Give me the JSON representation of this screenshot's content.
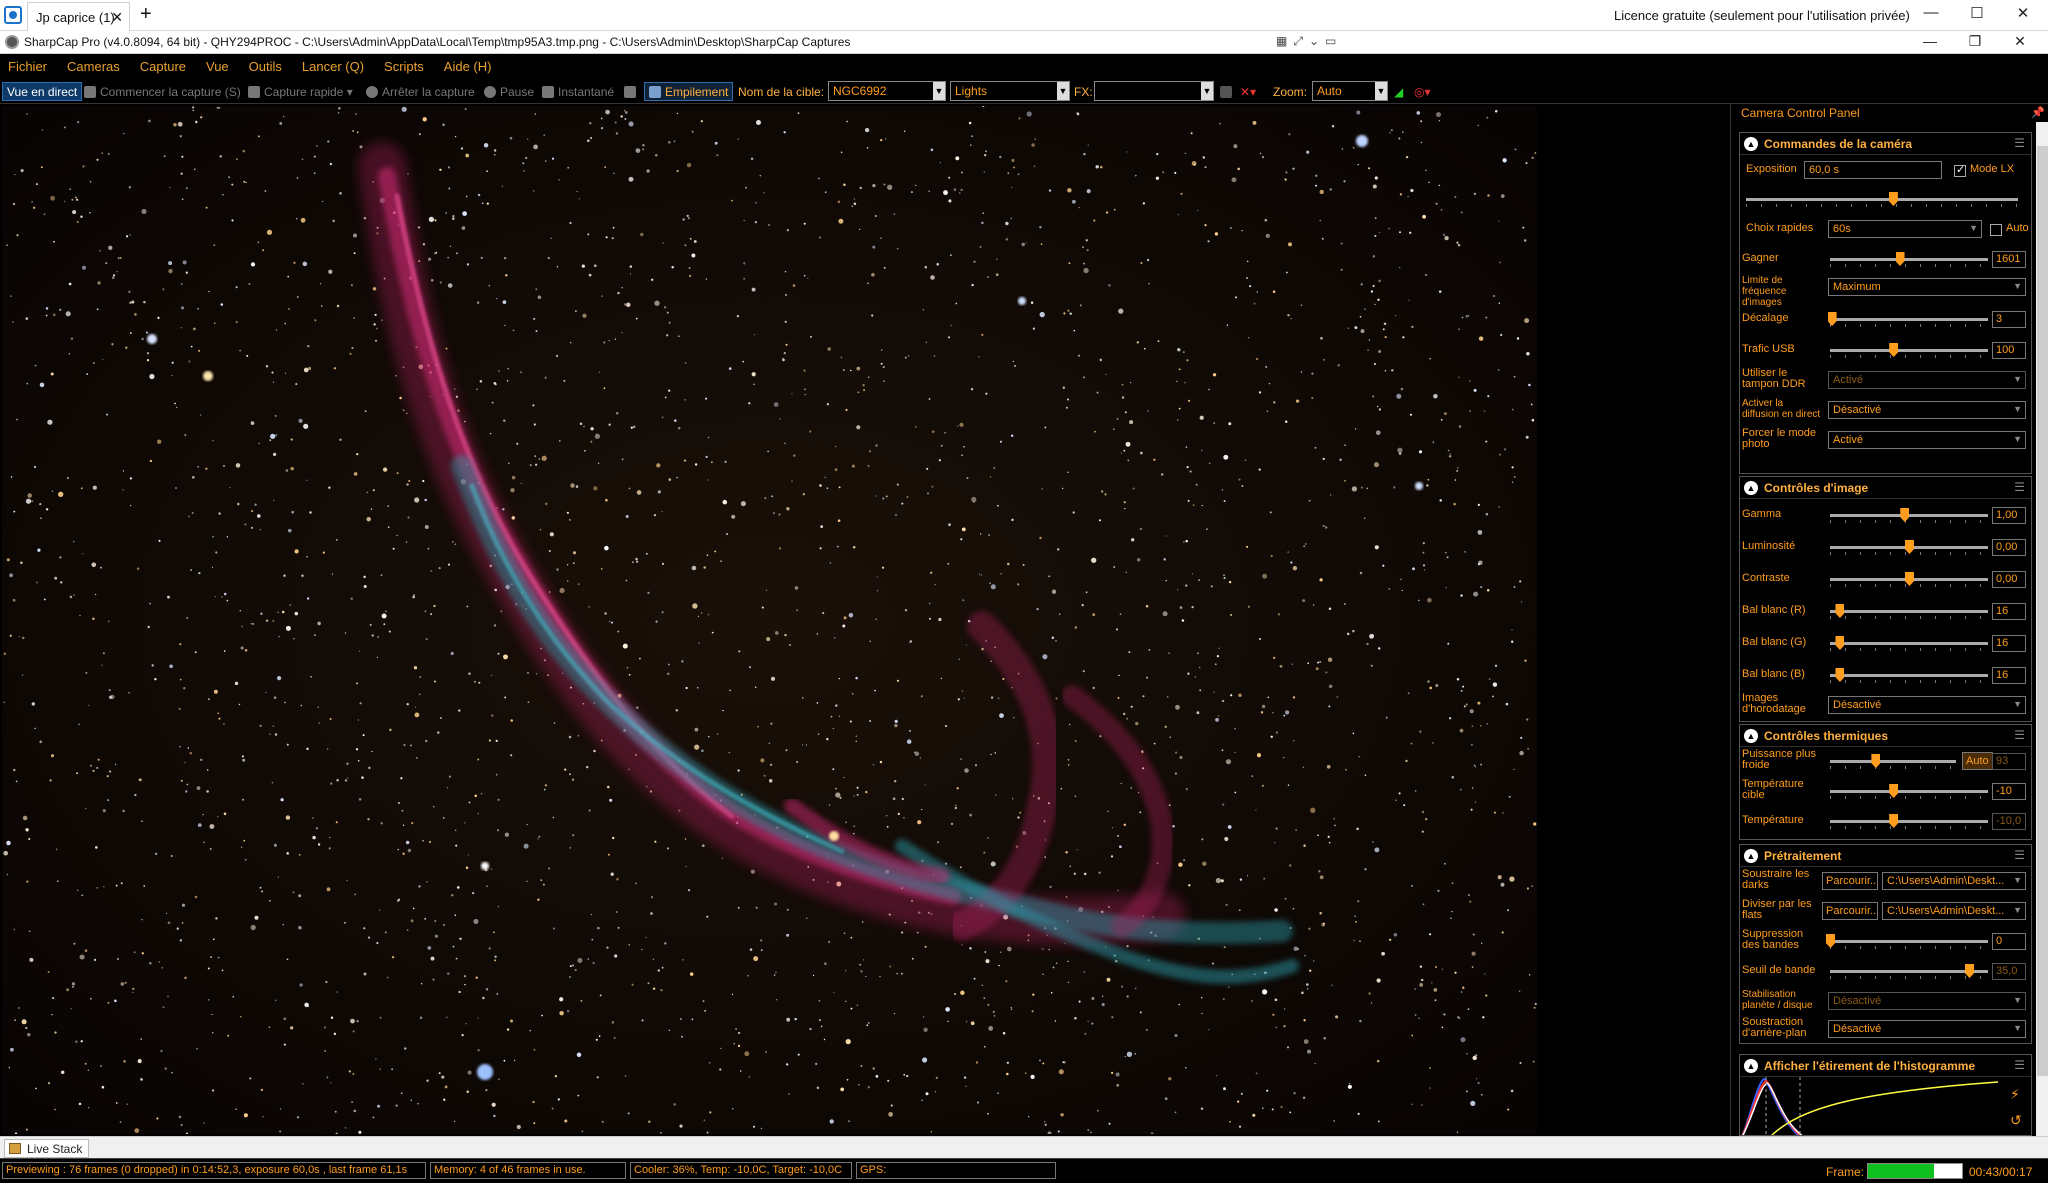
{
  "remote": {
    "tab_label": "Jp caprice (1)",
    "tab_close": "✕",
    "new_tab": "+",
    "licence": "Licence gratuite (seulement pour l'utilisation privée)"
  },
  "window": {
    "title": "SharpCap Pro (v4.0.8094, 64 bit) - QHY294PROC - C:\\Users\\Admin\\AppData\\Local\\Temp\\tmp95A3.tmp.png - C:\\Users\\Admin\\Desktop\\SharpCap Captures"
  },
  "menu": [
    "Fichier",
    "Cameras",
    "Capture",
    "Vue",
    "Outils",
    "Lancer (Q)",
    "Scripts",
    "Aide (H)"
  ],
  "toolbar": {
    "live_view": "Vue en direct",
    "start_capture": "Commencer la capture (S)",
    "quick_capture": "Capture rapide",
    "stop_capture": "Arrêter la capture",
    "pause": "Pause",
    "snapshot": "Instantané",
    "stacking": "Empilement",
    "target_label": "Nom de la cible:",
    "target_value": "NGC6992",
    "frame_type": "Lights",
    "fx_label": "FX:",
    "fx_value": "",
    "zoom_label": "Zoom:",
    "zoom_value": "Auto"
  },
  "panel": {
    "title": "Camera Control Panel",
    "camera": {
      "title": "Commandes de la caméra",
      "exposure_label": "Exposition",
      "exposure_value": "60,0 s",
      "exposure_pos": 0.54,
      "lx_mode_label": "Mode LX",
      "lx_mode_checked": true,
      "quick_choice_label": "Choix rapides",
      "quick_choice_value": "60s",
      "auto_label": "Auto",
      "gain_label": "Gagner",
      "gain_value": "1601",
      "gain_pos": 0.44,
      "fps_limit_label": "Limite de fréquence d'images",
      "fps_limit_value": "Maximum",
      "offset_label": "Décalage",
      "offset_value": "3",
      "offset_pos": 0.01,
      "usb_label": "Trafic USB",
      "usb_value": "100",
      "usb_pos": 0.4,
      "ddr_label": "Utiliser le tampon DDR",
      "ddr_value": "Activé",
      "stream_label": "Activer la diffusion en direct",
      "stream_value": "Désactivé",
      "photo_label": "Forcer le mode photo",
      "photo_value": "Activé"
    },
    "image": {
      "title": "Contrôles d'image",
      "gamma_label": "Gamma",
      "gamma_value": "1,00",
      "gamma_pos": 0.47,
      "brightness_label": "Luminosité",
      "brightness_value": "0,00",
      "brightness_pos": 0.5,
      "contrast_label": "Contraste",
      "contrast_value": "0,00",
      "contrast_pos": 0.5,
      "wbr_label": "Bal blanc (R)",
      "wbr_value": "16",
      "wbr_pos": 0.06,
      "wbg_label": "Bal blanc (G)",
      "wbg_value": "16",
      "wbg_pos": 0.06,
      "wbb_label": "Bal blanc (B)",
      "wbb_value": "16",
      "wbb_pos": 0.06,
      "timestamp_label": "Images d'horodatage",
      "timestamp_value": "Désactivé"
    },
    "thermal": {
      "title": "Contrôles thermiques",
      "power_label": "Puissance plus froide",
      "power_value": "93",
      "power_pos": 0.36,
      "power_auto": "Auto",
      "target_label": "Température cible",
      "target_value": "-10",
      "target_pos": 0.4,
      "temp_label": "Température",
      "temp_value": "-10,0",
      "temp_pos": 0.4
    },
    "preprocess": {
      "title": "Prétraitement",
      "darks_label": "Soustraire les darks",
      "darks_browse": "Parcourir...",
      "darks_path": "C:\\Users\\Admin\\Deskt...",
      "flats_label": "Diviser par les flats",
      "flats_browse": "Parcourir...",
      "flats_path": "C:\\Users\\Admin\\Deskt...",
      "banding_label": "Suppression des bandes",
      "banding_value": "0",
      "banding_pos": 0.0,
      "band_thresh_label": "Seuil de bande",
      "band_thresh_value": "35,0",
      "band_thresh_pos": 0.88,
      "stab_label": "Stabilisation planète / disque",
      "stab_value": "Désactivé",
      "bg_label": "Soustraction d'arrière-plan",
      "bg_value": "Désactivé"
    },
    "histogram": {
      "title": "Afficher l'étirement de l'histogramme"
    }
  },
  "bottom": {
    "live_stack_tab": "Live Stack"
  },
  "status": {
    "preview": "Previewing : 76 frames (0 dropped) in 0:14:52,3, exposure 60,0s , last frame 61,1s",
    "memory": "Memory: 4 of 46 frames in use.",
    "cooler": "Cooler: 36%, Temp: -10,0C, Target: -10,0C",
    "gps": "GPS:",
    "frame_label": "Frame:",
    "frame_progress": 0.7,
    "frame_time": "00:43/00:17"
  },
  "colors": {
    "accent": "#ff9d1e",
    "menu_text": "#e8a030",
    "progress_green": "#10c020",
    "nebula_red": "#c0246a",
    "nebula_teal": "#2a9aa8"
  }
}
